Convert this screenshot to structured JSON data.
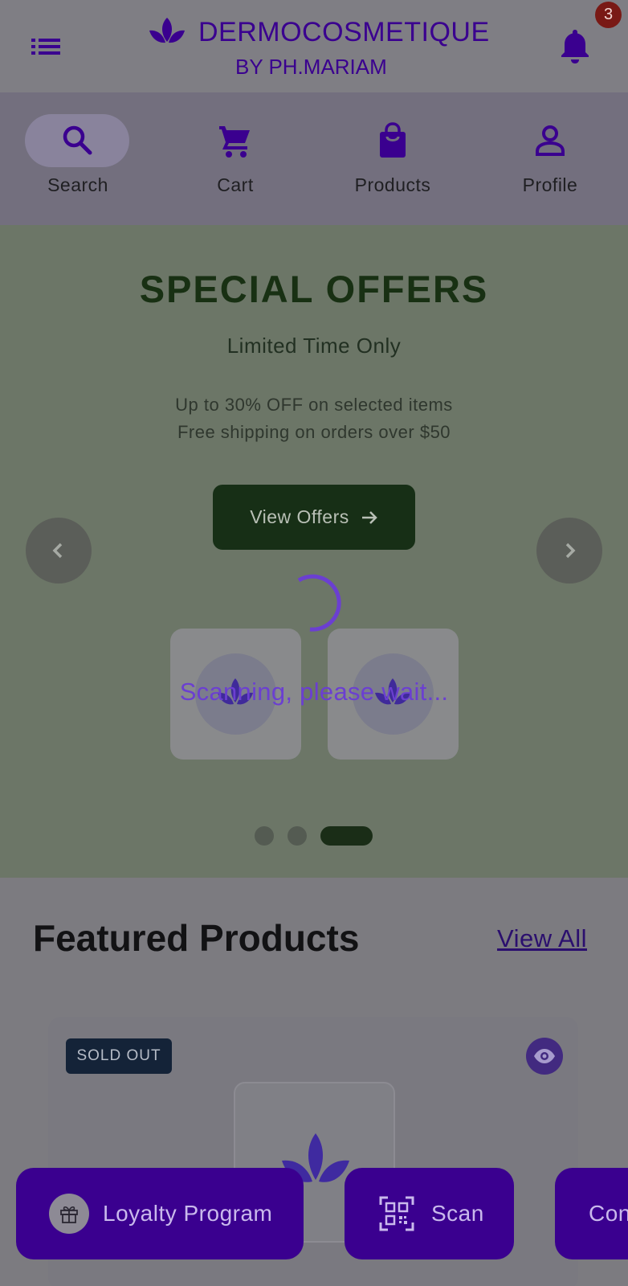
{
  "header": {
    "brand_title": "DERMOCOSMETIQUE",
    "brand_subtitle": "BY PH.MARIAM",
    "notification_count": "3",
    "menu_icon": "list-menu-icon",
    "bell_icon": "bell-icon",
    "logo_icon": "lotus-leaf-logo"
  },
  "nav": {
    "items": [
      {
        "label": "Search",
        "icon": "search-icon",
        "selected": true
      },
      {
        "label": "Cart",
        "icon": "cart-icon",
        "selected": false
      },
      {
        "label": "Products",
        "icon": "shopping-bag-icon",
        "selected": false
      },
      {
        "label": "Profile",
        "icon": "person-icon",
        "selected": false
      }
    ]
  },
  "hero": {
    "title": "SPECIAL OFFERS",
    "subtitle": "Limited Time Only",
    "line1": "Up to 30% OFF on selected items",
    "line2": "Free shipping on orders over $50",
    "button_label": "View Offers",
    "carousel_page": 3,
    "carousel_pages": 3
  },
  "overlay": {
    "loading_text": "Scanning, please wait..."
  },
  "featured": {
    "title": "Featured Products",
    "view_all_label": "View All",
    "product": {
      "badge": "SOLD OUT"
    }
  },
  "bottom_actions": {
    "loyalty_label": "Loyalty Program",
    "scan_label": "Scan",
    "contact_label": "Con"
  },
  "colors": {
    "brand": "#3a008f",
    "hero_dark": "#172f16",
    "badge_red": "#791915",
    "spinner": "#6b3fd1"
  }
}
